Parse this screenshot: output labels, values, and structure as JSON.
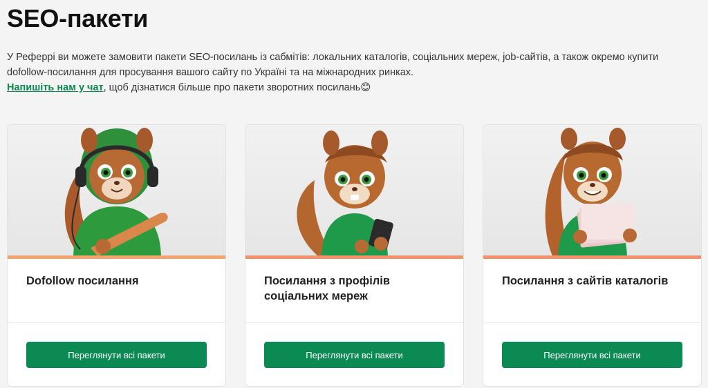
{
  "page": {
    "title": "SEO-пакети",
    "intro_line1": "У Реферрі ви можете замовити пакети SEO-посилань із сабмітів: локальних каталогів, соціальних мереж, job-сайтів, а також окремо купити",
    "intro_line2": "dofollow-посилання для просування вашого сайту по Україні та на міжнародних ринках.",
    "chat_link": "Напишіть нам у чат",
    "chat_suffix": ", щоб дізнатися більше про пакети зворотних посилань😊"
  },
  "cards": [
    {
      "title": "Dofollow посилання",
      "button": "Переглянути всі пакети",
      "image_icon": "squirrel-headphones-bat-illustration"
    },
    {
      "title": "Посилання з профілів соціальних мереж",
      "button": "Переглянути всі пакети",
      "image_icon": "squirrel-phone-illustration"
    },
    {
      "title": "Посилання з сайтів каталогів",
      "button": "Переглянути всі пакети",
      "image_icon": "squirrel-papers-illustration"
    }
  ],
  "colors": {
    "accent_green": "#0b8a54",
    "link_green": "#0a8a4e",
    "card_image_border": "#f4a36e"
  }
}
